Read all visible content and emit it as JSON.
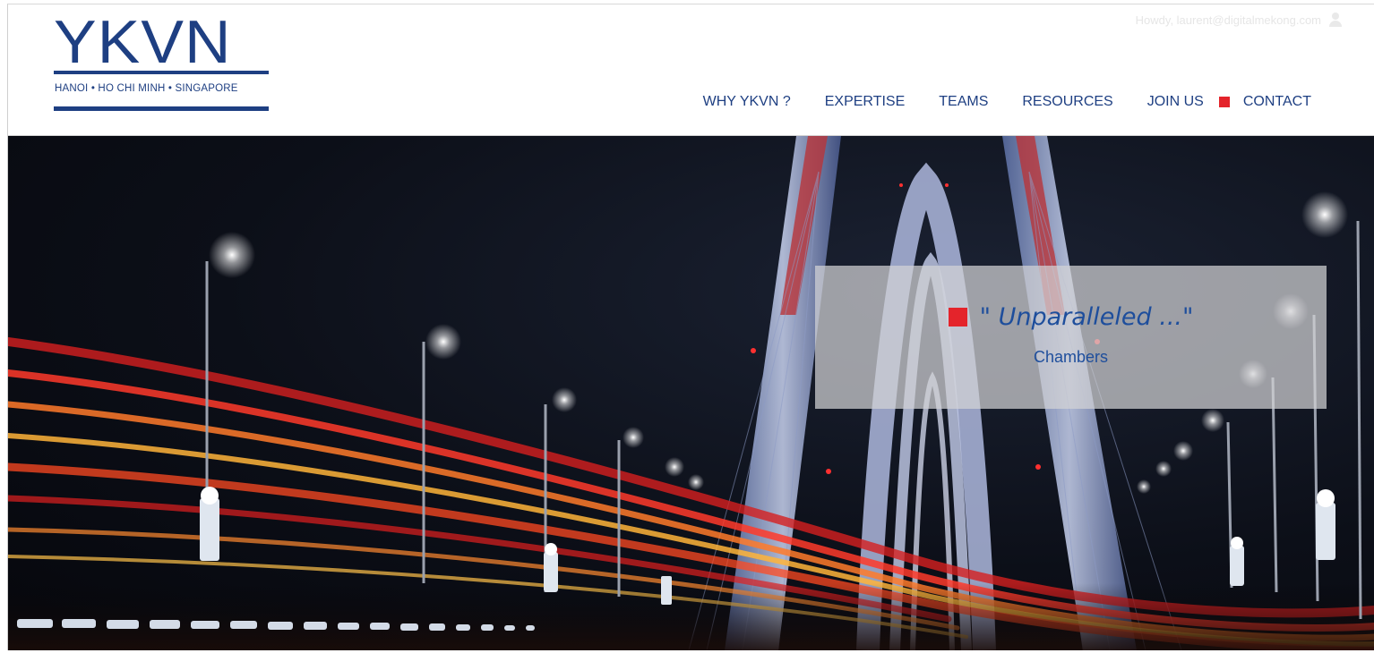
{
  "header": {
    "logo": {
      "wordmark": "YKVN",
      "cities": "HANOI • HO CHI MINH • SINGAPORE"
    },
    "user_greeting": "Howdy, laurent@digitalmekong.com",
    "nav": {
      "items": [
        {
          "label": "WHY YKVN ?"
        },
        {
          "label": "EXPERTISE"
        },
        {
          "label": "TEAMS"
        },
        {
          "label": "RESOURCES"
        },
        {
          "label": "JOIN US"
        },
        {
          "label": "CONTACT"
        }
      ]
    }
  },
  "hero": {
    "quote": "\" Unparalleled ...\"",
    "source": "Chambers"
  },
  "colors": {
    "brand_blue": "#1e3f82",
    "accent_red": "#e4242b",
    "quote_blue": "#1e4e9c"
  }
}
